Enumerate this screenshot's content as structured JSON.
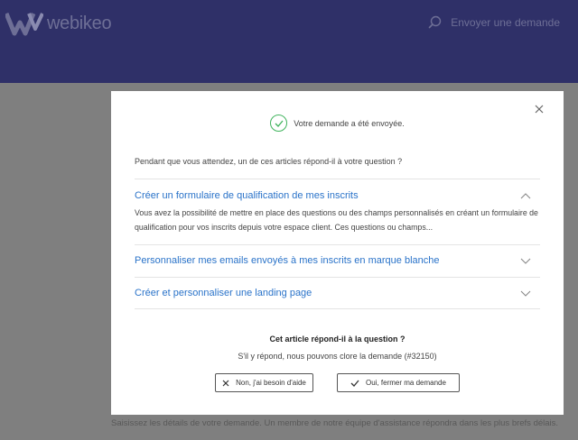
{
  "header": {
    "brand": "webikeo",
    "action_label": "Envoyer une demande",
    "icons": {
      "logo": "webikeo-logo-mark",
      "action": "search-icon"
    },
    "colors": {
      "background": "#2f3068",
      "muted_text": "#6e6f96"
    }
  },
  "background": {
    "footer_text": "Saisissez les détails de votre demande. Un membre de notre équipe d'assistance répondra dans les plus brefs délais."
  },
  "modal": {
    "close_icon": "close-icon",
    "confirmation": {
      "text": "Votre demande a été envoyée.",
      "icon": "check-circle-icon",
      "color": "#3fb35c"
    },
    "intro": "Pendant que vous attendez, un de ces articles répond-il à votre question ?",
    "articles": [
      {
        "title": "Créer un formulaire de qualification de mes inscrits",
        "expanded": true,
        "body": "Vous avez la possibilité de mettre en place des questions ou des champs personnalisés en créant un formulaire de qualification pour vos inscrits depuis votre espace client. Ces questions ou champs..."
      },
      {
        "title": "Personnaliser mes emails envoyés à mes inscrits en marque blanche",
        "expanded": false
      },
      {
        "title": "Créer et personnaliser une landing page",
        "expanded": false
      }
    ],
    "link_color": "#2a73c9",
    "question": {
      "title": "Cet article répond-il à la question ?",
      "subtitle": "S'il y répond, nous pouvons clore la demande (#32150)"
    },
    "buttons": {
      "no": {
        "label": "Non, j'ai besoin d'aide",
        "icon": "x-icon"
      },
      "yes": {
        "label": "Oui, fermer ma demande",
        "icon": "check-icon"
      }
    }
  }
}
